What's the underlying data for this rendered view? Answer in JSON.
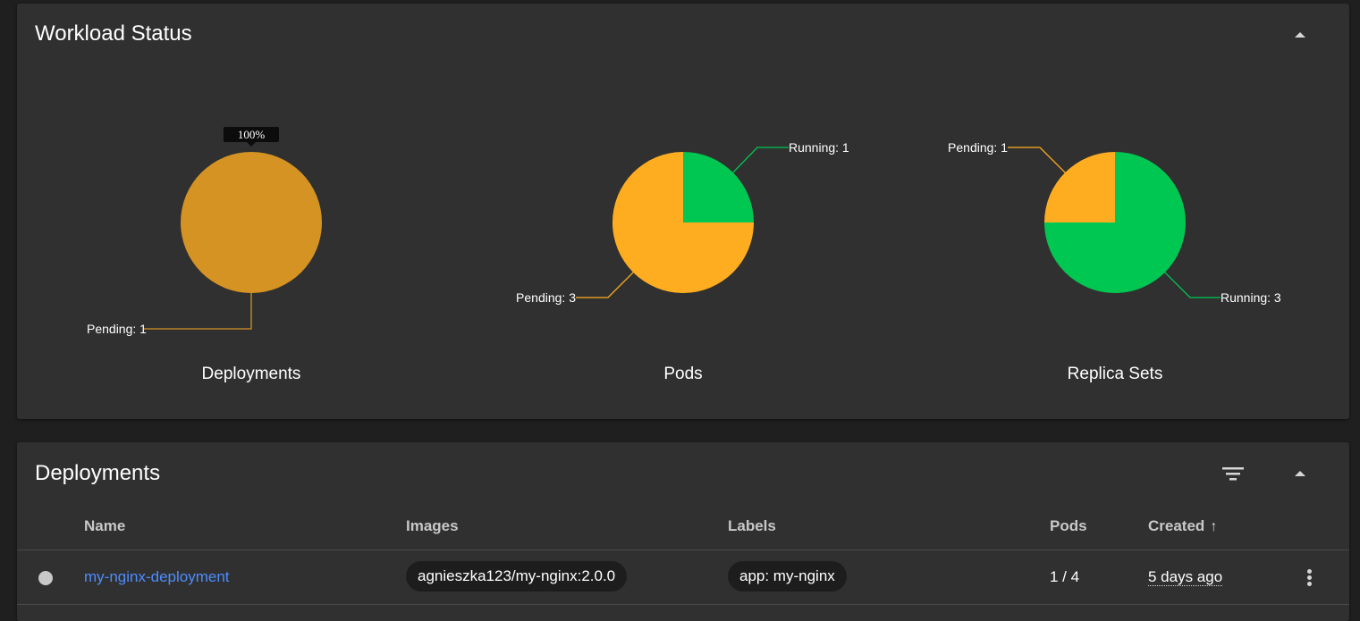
{
  "workload_status": {
    "title": "Workload Status",
    "charts": [
      {
        "caption": "Deployments",
        "tooltip": "100%",
        "slices": [
          {
            "label": "Pending",
            "value": 1,
            "color": "#d49322",
            "text": "Pending: 1"
          }
        ]
      },
      {
        "caption": "Pods",
        "slices": [
          {
            "label": "Running",
            "value": 1,
            "color": "#00c752",
            "text": "Running: 1"
          },
          {
            "label": "Pending",
            "value": 3,
            "color": "#ffad20",
            "text": "Pending: 3"
          }
        ]
      },
      {
        "caption": "Replica Sets",
        "slices": [
          {
            "label": "Running",
            "value": 3,
            "color": "#00c752",
            "text": "Running: 3"
          },
          {
            "label": "Pending",
            "value": 1,
            "color": "#ffad20",
            "text": "Pending: 1"
          }
        ]
      }
    ]
  },
  "chart_data": [
    {
      "type": "pie",
      "title": "Deployments",
      "categories": [
        "Pending"
      ],
      "values": [
        1
      ]
    },
    {
      "type": "pie",
      "title": "Pods",
      "categories": [
        "Running",
        "Pending"
      ],
      "values": [
        1,
        3
      ]
    },
    {
      "type": "pie",
      "title": "Replica Sets",
      "categories": [
        "Running",
        "Pending"
      ],
      "values": [
        3,
        1
      ]
    }
  ],
  "deployments": {
    "title": "Deployments",
    "columns": {
      "name": "Name",
      "images": "Images",
      "labels": "Labels",
      "pods": "Pods",
      "created": "Created",
      "created_sort_icon": "arrow-up-icon"
    },
    "rows": [
      {
        "status": "pending",
        "name": "my-nginx-deployment",
        "image": "agnieszka123/my-nginx:2.0.0",
        "label": "app: my-nginx",
        "pods": "1 / 4",
        "created": "5 days ago"
      }
    ]
  },
  "icons": {
    "collapse": "chevron-up-icon",
    "filter": "filter-icon",
    "menu": "more-vert-icon"
  },
  "colors": {
    "running": "#00c752",
    "pending": "#ffad20",
    "pending_single": "#d49322",
    "link": "#4d8dff",
    "card": "#303030",
    "background": "#1f1f1f"
  }
}
